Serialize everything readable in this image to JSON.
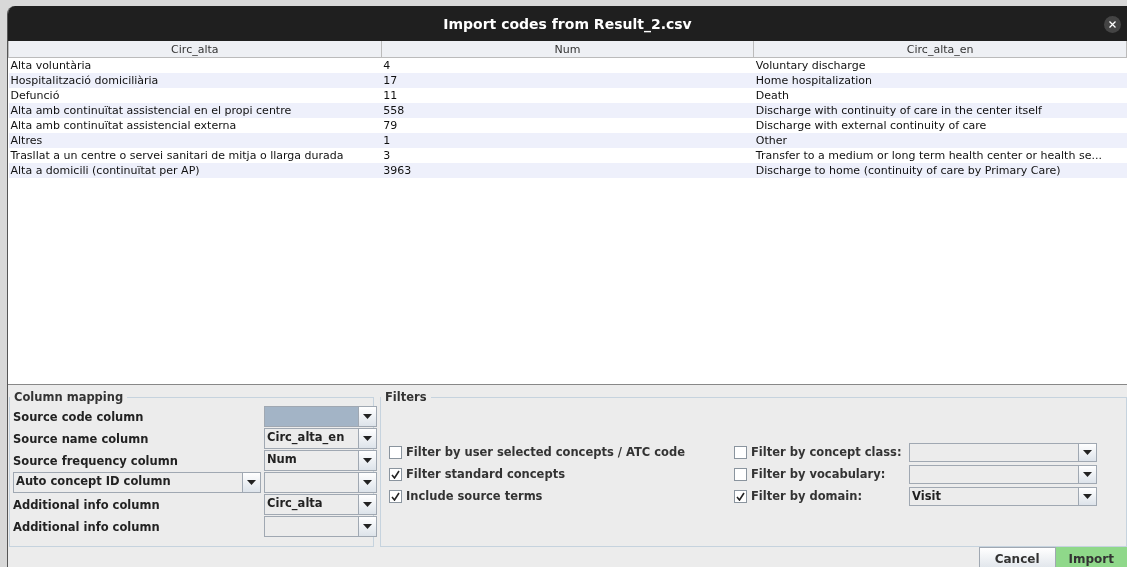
{
  "window": {
    "title": "Import codes from Result_2.csv"
  },
  "table": {
    "columns": [
      "Circ_alta",
      "Num",
      "Circ_alta_en"
    ],
    "rows": [
      [
        "Alta voluntària",
        "4",
        "Voluntary discharge"
      ],
      [
        "Hospitalització domiciliària",
        "17",
        "Home hospitalization"
      ],
      [
        "Defunció",
        "11",
        "Death"
      ],
      [
        "Alta amb continuïtat assistencial en el propi centre",
        "558",
        "Discharge with continuity of care in the center itself"
      ],
      [
        "Alta amb continuïtat assistencial externa",
        "79",
        "Discharge with external continuity of care"
      ],
      [
        "Altres",
        "1",
        "Other"
      ],
      [
        "Trasllat a un centre o servei sanitari de mitja o llarga durada",
        "3",
        "Transfer to a medium or long term health center or health se..."
      ],
      [
        "Alta a domicili (continuïtat per AP)",
        "3963",
        "Discharge to home (continuity of care by Primary Care)"
      ]
    ]
  },
  "column_mapping": {
    "title": "Column mapping",
    "rows": [
      {
        "kind": "label",
        "label": "Source code column",
        "focused": true
      },
      {
        "kind": "label",
        "label": "Source name column",
        "value": "Circ_alta_en",
        "focused": false
      },
      {
        "kind": "label",
        "label": "Source frequency column",
        "value": "Num",
        "focused": false
      },
      {
        "kind": "combo",
        "label": "Auto concept ID column",
        "focused": false
      },
      {
        "kind": "label",
        "label": "Additional info column",
        "value": "Circ_alta",
        "focused": false
      },
      {
        "kind": "label",
        "label": "Additional info column",
        "focused": false
      }
    ]
  },
  "filters": {
    "title": "Filters",
    "left": [
      {
        "label": "Filter by user selected concepts / ATC code",
        "checked": false
      },
      {
        "label": "Filter standard concepts",
        "checked": true
      },
      {
        "label": "Include source terms",
        "checked": true
      }
    ],
    "right": [
      {
        "label": "Filter by concept class:",
        "checked": false
      },
      {
        "label": "Filter by vocabulary:",
        "checked": false
      },
      {
        "label": "Filter by domain:",
        "checked": true,
        "value": "Visit"
      }
    ]
  },
  "buttons": [
    {
      "label": "Cancel",
      "kind": "normal"
    },
    {
      "label": "Import",
      "kind": "primary"
    }
  ]
}
